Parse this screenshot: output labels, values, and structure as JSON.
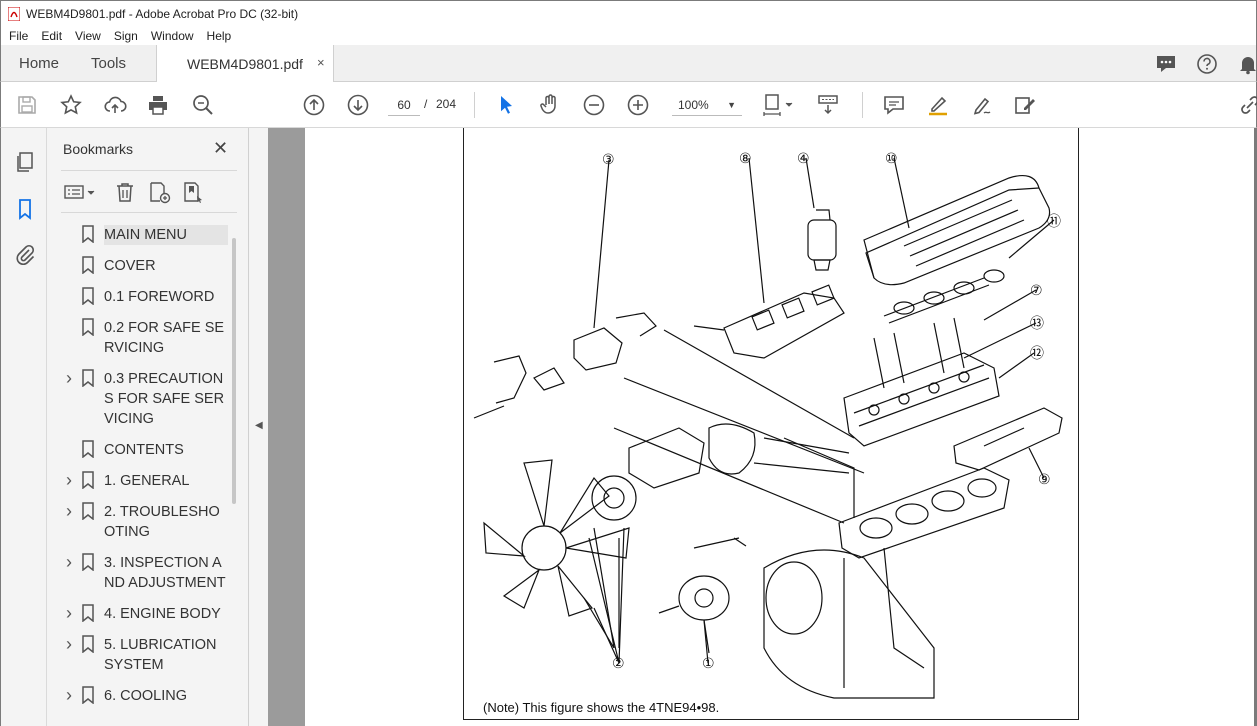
{
  "window": {
    "title": "WEBM4D9801.pdf - Adobe Acrobat Pro DC (32-bit)"
  },
  "menu": [
    "File",
    "Edit",
    "View",
    "Sign",
    "Window",
    "Help"
  ],
  "tabs": {
    "home": "Home",
    "tools": "Tools",
    "document": "WEBM4D9801.pdf",
    "close": "×"
  },
  "toolbar": {
    "current_page": "60",
    "separator": "/",
    "total_pages": "204",
    "zoom": "100%"
  },
  "bookmarks": {
    "title": "Bookmarks",
    "close": "✕",
    "items": [
      {
        "label": "MAIN MENU",
        "expandable": false,
        "selected": true
      },
      {
        "label": "COVER",
        "expandable": false
      },
      {
        "label": "0.1 FOREWORD",
        "expandable": false
      },
      {
        "label": "0.2 FOR SAFE SERVICING",
        "expandable": false
      },
      {
        "label": "0.3 PRECAUTIONS FOR SAFE SERVICING",
        "expandable": true
      },
      {
        "label": "CONTENTS",
        "expandable": false
      },
      {
        "label": "1. GENERAL",
        "expandable": true
      },
      {
        "label": "2. TROUBLESHOOTING",
        "expandable": true
      },
      {
        "label": "3. INSPECTION AND ADJUSTMENT",
        "expandable": true
      },
      {
        "label": "4. ENGINE BODY",
        "expandable": true
      },
      {
        "label": "5. LUBRICATION SYSTEM",
        "expandable": true
      },
      {
        "label": "6. COOLING",
        "expandable": true
      }
    ]
  },
  "document": {
    "note": "(Note)  This figure shows the 4TNE94•98.",
    "callouts": [
      "③",
      "⑧",
      "④",
      "⑩",
      "⑪",
      "⑦",
      "⑬",
      "⑫",
      "⑨",
      "②",
      "①"
    ]
  }
}
